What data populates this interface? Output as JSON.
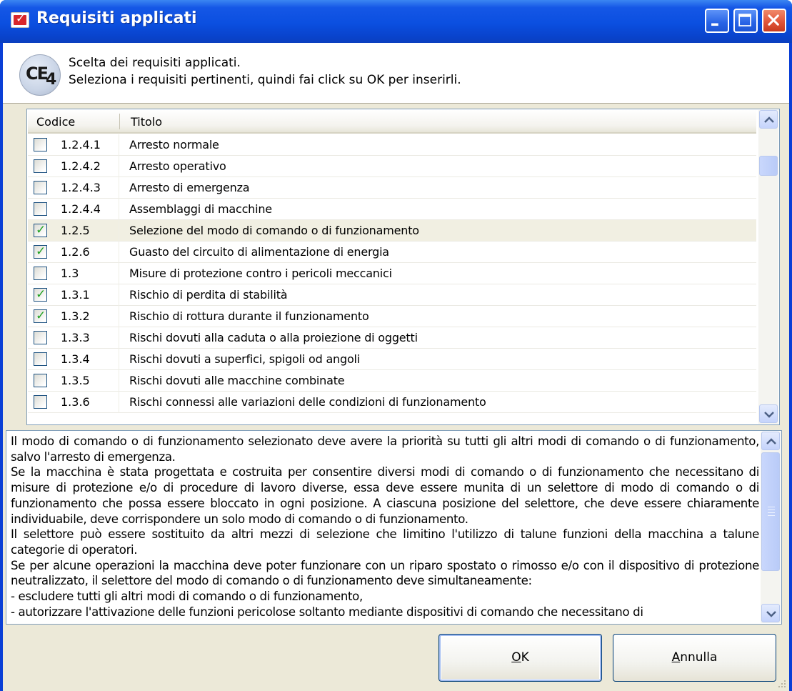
{
  "window": {
    "title": "Requisiti applicati",
    "controls": {
      "minimize": "minimize",
      "maximize": "maximize",
      "close": "close"
    }
  },
  "header": {
    "logo": "CE4",
    "line1": "Scelta dei requisiti applicati.",
    "line2": "Seleziona i requisiti pertinenti, quindi fai click su OK per inserirli."
  },
  "table": {
    "columns": {
      "code": "Codice",
      "title": "Titolo"
    },
    "rows": [
      {
        "code": "1.2.4.1",
        "title": "Arresto normale",
        "checked": false
      },
      {
        "code": "1.2.4.2",
        "title": "Arresto operativo",
        "checked": false
      },
      {
        "code": "1.2.4.3",
        "title": "Arresto di emergenza",
        "checked": false
      },
      {
        "code": "1.2.4.4",
        "title": "Assemblaggi di macchine",
        "checked": false
      },
      {
        "code": "1.2.5",
        "title": "Selezione del modo di comando o di funzionamento",
        "checked": true,
        "selected": true
      },
      {
        "code": "1.2.6",
        "title": "Guasto del circuito di alimentazione di energia",
        "checked": true
      },
      {
        "code": "1.3",
        "title": "Misure di protezione contro i pericoli meccanici",
        "checked": false
      },
      {
        "code": "1.3.1",
        "title": "Rischio di perdita di stabilità",
        "checked": true
      },
      {
        "code": "1.3.2",
        "title": "Rischio di rottura durante il funzionamento",
        "checked": true
      },
      {
        "code": "1.3.3",
        "title": "Rischi dovuti alla caduta o alla proiezione di oggetti",
        "checked": false
      },
      {
        "code": "1.3.4",
        "title": "Rischi dovuti a superfici, spigoli od angoli",
        "checked": false
      },
      {
        "code": "1.3.5",
        "title": "Rischi dovuti alle macchine combinate",
        "checked": false
      },
      {
        "code": "1.3.6",
        "title": "Rischi connessi alle variazioni delle condizioni di funzionamento",
        "checked": false
      }
    ]
  },
  "description": {
    "paragraphs": [
      "Il modo di comando o di funzionamento selezionato deve avere la priorità su tutti gli altri modi di comando o di funzionamento, salvo l'arresto di emergenza.",
      "Se la macchina è stata progettata e costruita per consentire diversi modi di comando o di funzionamento che necessitano di misure di protezione e/o di procedure di lavoro diverse, essa deve essere munita di un selettore di modo di comando o di funzionamento che possa essere bloccato in ogni posizione. A ciascuna posizione del selettore, che deve essere chiaramente individuabile, deve corrispondere un solo modo di comando o di funzionamento.",
      "Il selettore può essere sostituito da altri mezzi di selezione che limitino l'utilizzo di talune funzioni della macchina a talune categorie di operatori.",
      "Se per alcune operazioni la macchina deve poter funzionare con un riparo spostato o rimosso e/o con il dispositivo di protezione neutralizzato, il selettore del modo di comando o di funzionamento deve simultaneamente:",
      "- escludere tutti gli altri modi di comando o di funzionamento,",
      "- autorizzare l'attivazione delle funzioni pericolose soltanto mediante dispositivi di comando che necessitano di"
    ]
  },
  "buttons": {
    "ok": {
      "label_ul": "O",
      "label_rest": "K"
    },
    "cancel": {
      "label_ul": "A",
      "label_rest": "nnulla"
    }
  },
  "colors": {
    "title_bar": "#0b4fe0",
    "window_bg": "#ece9d8",
    "selected_row": "#f1efe2",
    "checkmark": "#21a121"
  },
  "scroll": {
    "list_position": 0.1,
    "description_position": 0.05
  }
}
